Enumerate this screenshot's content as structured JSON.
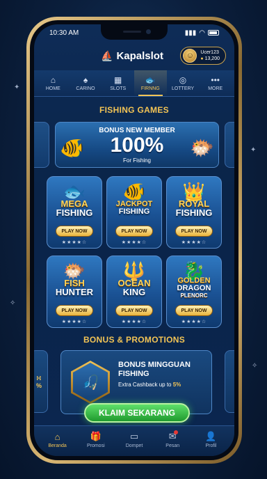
{
  "status_bar": {
    "time": "10:30 AM"
  },
  "brand": {
    "name": "Kapalslot",
    "icon": "ship-icon"
  },
  "user": {
    "name": "Ucer123",
    "balance": "13,200",
    "avatar_icon": "avatar-icon"
  },
  "nav": {
    "items": [
      {
        "label": "HOME",
        "icon": "home-icon",
        "active": false
      },
      {
        "label": "CARINO",
        "icon": "cards-icon",
        "active": false
      },
      {
        "label": "SLOTS",
        "icon": "slot-icon",
        "active": false
      },
      {
        "label": "FIRNNG",
        "icon": "fish-icon",
        "active": true
      },
      {
        "label": "LOTTERY",
        "icon": "lottery-icon",
        "active": false
      },
      {
        "label": "MORE",
        "icon": "more-icon",
        "active": false
      }
    ]
  },
  "fishing": {
    "title": "FISHING GAMES",
    "banner": {
      "title": "BONUS NEW MEMBER",
      "percent": "100%",
      "subtitle": "For Fishing"
    },
    "games": [
      {
        "line1": "MEGA",
        "line2": "FISHING",
        "button": "PLAY NOW",
        "stars": "★★★★☆"
      },
      {
        "line1": "JACKPOT",
        "line2": "FISHING",
        "button": "PLAY NOW",
        "stars": "★★★★☆"
      },
      {
        "line1": "ROYAL",
        "line2": "FISHING",
        "button": "PLAY NOW",
        "stars": "★★★★☆"
      },
      {
        "line1": "FISH",
        "line2": "HUNTER",
        "button": "PLAY NOW",
        "stars": "★★★★☆"
      },
      {
        "line1": "OCEAN",
        "line2": "KING",
        "button": "PLAY NOW",
        "stars": "★★★★☆"
      },
      {
        "line1": "GOLDEN",
        "line2": "DRAGON",
        "line3": "PLENORC",
        "button": "PLAY NOW",
        "stars": "★★★★☆"
      }
    ]
  },
  "promotions": {
    "title": "BONUS & PROMOTIONS",
    "peek_left": "∺\n%",
    "card": {
      "title": "BONUS MINGGUAN FISHING",
      "subtitle_prefix": "Extra Cashback up to ",
      "subtitle_highlight": "5%"
    },
    "claim_button": "KLAIM SEKARANG"
  },
  "bottom_nav": {
    "items": [
      {
        "label": "Beranda",
        "icon": "home-icon",
        "active": true
      },
      {
        "label": "Promosi",
        "icon": "gift-icon",
        "active": false
      },
      {
        "label": "Dompet",
        "icon": "wallet-icon",
        "active": false
      },
      {
        "label": "Pesan",
        "icon": "chat-icon",
        "active": false,
        "notification": true
      },
      {
        "label": "Profil",
        "icon": "user-icon",
        "active": false
      }
    ]
  }
}
